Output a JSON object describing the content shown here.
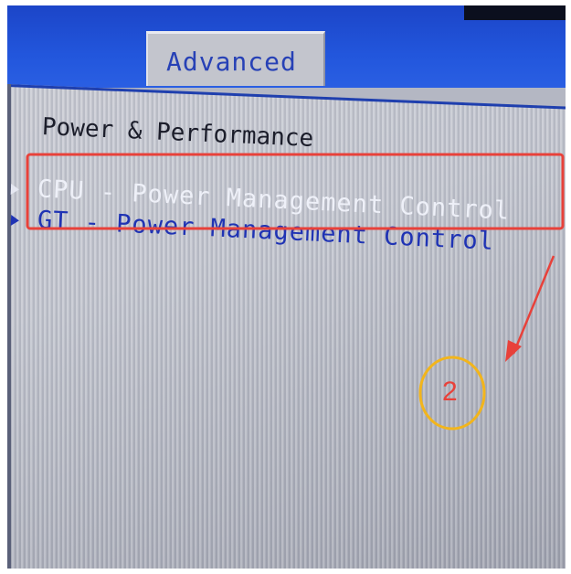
{
  "bios": {
    "active_tab": "Advanced",
    "section_title": "Power & Performance",
    "menu_items": [
      {
        "label": "CPU - Power Management Control",
        "highlighted": true
      },
      {
        "label": "GT - Power Management Control",
        "highlighted": false
      }
    ]
  },
  "annotation": {
    "step_number": "2",
    "box_color": "#e8413a",
    "arrow_color": "#e8413a",
    "circle_color": "#f2b51c"
  },
  "colors": {
    "header_blue": "#2256dc",
    "screen_gray": "#bfc2cc",
    "selected_text": "#eef0f8",
    "item_text": "#1f33b4"
  }
}
